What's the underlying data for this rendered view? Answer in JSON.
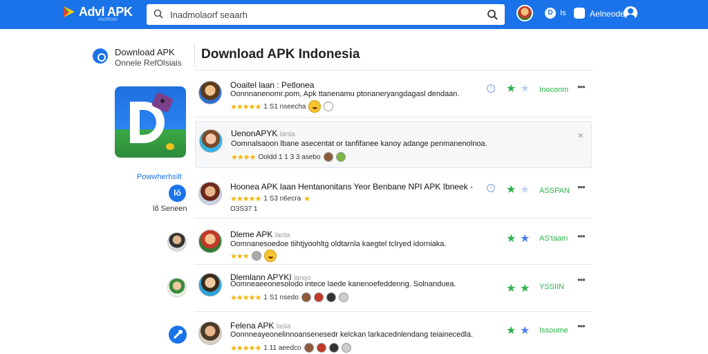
{
  "header": {
    "logo_text": "Advl APK",
    "logo_sub": "ANDROID",
    "search_placeholder": "Inadmolaorf seaarh",
    "top_text1": "Is",
    "top_text2": "Aelneode"
  },
  "sidebar": {
    "brand_title": "Download APK",
    "brand_sub": "Onnele RefOlsiais",
    "dev_label": "Powwherhsilt",
    "dev_icon": "lō",
    "dev_count": "lő Seneen"
  },
  "main": {
    "title": "Download APK Indonesia",
    "cards": [
      {
        "name": "Ooaitel laan : Petlonea",
        "tag": "",
        "desc": "Oonnnanenomr.pom, Apk ttanenamu ptonaneryangdagasl dendaan.",
        "rating": "1 S1 nseecha",
        "stars": "★★★★★",
        "status": "Inoconm",
        "more": "•••",
        "info": "!"
      },
      {
        "name": "UenonAPYK",
        "tag": "lanta",
        "desc": "Oomnalsaoon lbane asecentat or tanfifanee kanoy adange penmanenolnoa.",
        "rating": "Ooldd 1 1 3 3 asebo",
        "stars": "★★★★",
        "status": "",
        "more": "",
        "close": "✕"
      },
      {
        "name": "Hoonea APK laan Hentanonitans Yeor Benbane NPI APK Ibneek -",
        "tag": "",
        "desc": "",
        "rating": "1 S3 n6ecra",
        "stars": "★★★★★",
        "sub": "O3S37 1",
        "status": "ASSPAN",
        "more": "•••",
        "info": "!"
      },
      {
        "name": "Dleme APK",
        "tag": "lanta",
        "desc": "Oomnanesoedoe tiihtjyoohltg oldtarnla kaegtel tclryed idorniaka.",
        "rating": "",
        "stars": "★★★",
        "status": "AS'taam",
        "more": "•••"
      },
      {
        "name": "Dlemlann APYKI",
        "tag": "lanoo",
        "desc": "Oomneaeeonesolodo intece laede kanenoefeddenng. Solnanduea.",
        "rating": "1 S1 nsedo",
        "stars": "★★★★★",
        "status": "YSSIIN",
        "more": "•••"
      },
      {
        "name": "Felena APK",
        "tag": "lasla",
        "desc": "Oonnneayeonelinnoansenesedr kelckan larkacednlendang teiainecedla.",
        "rating": "1 11 aeedco",
        "stars": "★★★★★",
        "status": "Issoume",
        "more": "•••"
      }
    ]
  },
  "colors": {
    "accent": "#1a73e8",
    "status_green": "#2db24a",
    "star": "#f5b301"
  }
}
